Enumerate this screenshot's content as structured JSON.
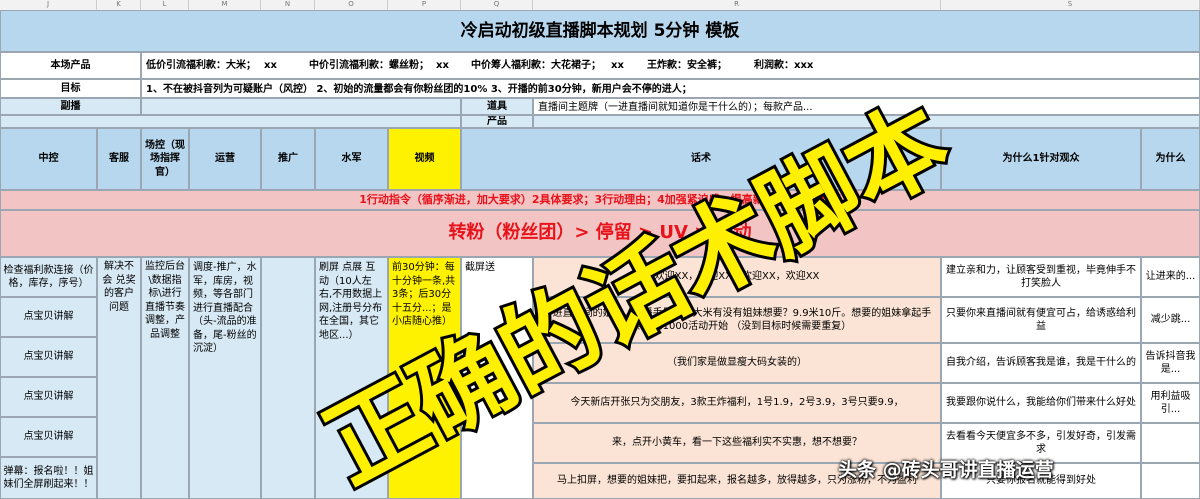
{
  "col_letters": [
    "J",
    "K",
    "L",
    "M",
    "N",
    "O",
    "P",
    "Q",
    "R",
    "S"
  ],
  "title": "冷启动初级直播脚本规划 5分钟 模板",
  "products": {
    "label": "本场产品",
    "items": [
      {
        "name": "低价引流福利款：大米；",
        "val": "xx"
      },
      {
        "name": "中价引流福利款：螺丝粉；",
        "val": "xx"
      },
      {
        "name": "中价筹人福利款：大花裙子；",
        "val": "xx"
      },
      {
        "name": "王炸款：安全裤；",
        "val": ""
      },
      {
        "name": "利润款：xxx",
        "val": ""
      }
    ]
  },
  "goal": {
    "label": "目标",
    "text": "1、不在被抖音列为可疑账户（风控）   2、初始的流量都会有你粉丝团的10%   3、开播的前30分钟，新用户会不停的进人；"
  },
  "row3": {
    "label": "副播",
    "props_label": "道具",
    "props_text": "直播间主题牌（一进直播间就知道你是干什么的）；每款产品..."
  },
  "row4": {
    "product_label": "产品"
  },
  "headers": [
    "中控",
    "客服",
    "场控（现场指挥官）",
    "运营",
    "推广",
    "水军",
    "视频",
    "话术",
    "为什么1针对观众",
    "为什么"
  ],
  "banner1": "1行动指令（循序渐进，加大要求）2具体要求；3行动理由；4加强紧迫感，提高新人，一眼见秒懂",
  "banner2": "转粉（粉丝团）> 停留 > UV > 互动",
  "col_zhongkong": [
    "检查福利款连接（价格，库存，序号）",
    "点宝贝讲解",
    "点宝贝讲解",
    "点宝贝讲解",
    "点宝贝讲解",
    "弹幕：报名啦！！姐妹们全屏刷起来！！"
  ],
  "col_kefu": "解决不会 兑奖 的客户问题",
  "col_changkong": "监控后台\\数据指标\\进行直播节奏调整，产品调整",
  "col_yunying": "调度-推广，水军，库房，视频，等各部门进行直播配合（头-流品的准备，尾-粉丝的沉淀）",
  "col_shuijun": "刷屏 点展 互动（10人左右,不用数据上网,注册号分布在全国，其它地区...）",
  "col_video": "前30分钟：每十分钟一条,共3条；后30分十五分...；是小店随心推）",
  "col_video_head": "截屏送",
  "script_lines": [
    "欢迎XX，欢迎XX，欢迎XX，欢迎XX",
    "新进直播间的姐妹，主播手里拿的大米有没有姐妹想要？9.9米10斤。想要的姐妹拿起手机点赞到1000活动开始 （没到目标时候需要重复）",
    "（我们家是做显瘦大码女装的）",
    "今天新店开张只为交朋友，3款王炸福利，1号1.9，2号3.9，3号只要9.9，",
    "来，点开小黄车，看一下这些福利实不实惠，想不想要？",
    "马上扣屏，想要的姐妹把，要扣起来，报名越多，放得越多，只为涨粉，不为盈利"
  ],
  "why_lines": [
    "建立亲和力，让顾客受到重视，毕竟伸手不打笑脸人",
    "只要你来直播间就有便宜可占，给诱惑给利益",
    "自我介绍，告诉顾客我是谁，我是干什么的",
    "我要跟你说什么，我能给你们带来什么好处",
    "去看看今天便宜多不多，引发好奇，引发需求",
    "只要你报名就能得到好处"
  ],
  "why2_lines": [
    "让进来的...",
    "减少跳...",
    "告诉抖音我是...",
    "用利益吸引...",
    "",
    ""
  ],
  "overlay_text": "正确的话术脚本",
  "watermark": "头条 @砖头哥讲直播运营"
}
